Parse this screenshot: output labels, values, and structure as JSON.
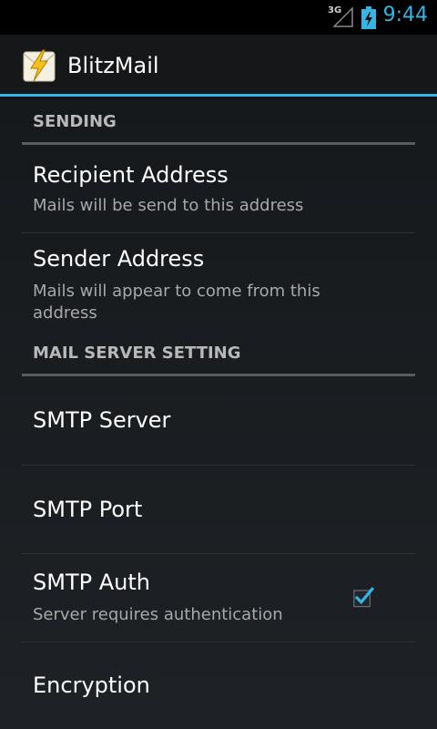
{
  "status_bar": {
    "network": "3G",
    "time": "9:44",
    "accent_color": "#33b5e5"
  },
  "action_bar": {
    "title": "BlitzMail",
    "icon": "blitzmail-app-icon"
  },
  "sections": [
    {
      "header": "SENDING",
      "items": [
        {
          "title": "Recipient Address",
          "summary": "Mails will be send to this address"
        },
        {
          "title": "Sender Address",
          "summary": "Mails will appear to come from this address"
        }
      ]
    },
    {
      "header": "MAIL SERVER SETTING",
      "items": [
        {
          "title": "SMTP Server",
          "summary": ""
        },
        {
          "title": "SMTP Port",
          "summary": ""
        },
        {
          "title": "SMTP Auth",
          "summary": "Server requires authentication",
          "checked": true
        },
        {
          "title": "Encryption",
          "summary": ""
        }
      ]
    }
  ]
}
